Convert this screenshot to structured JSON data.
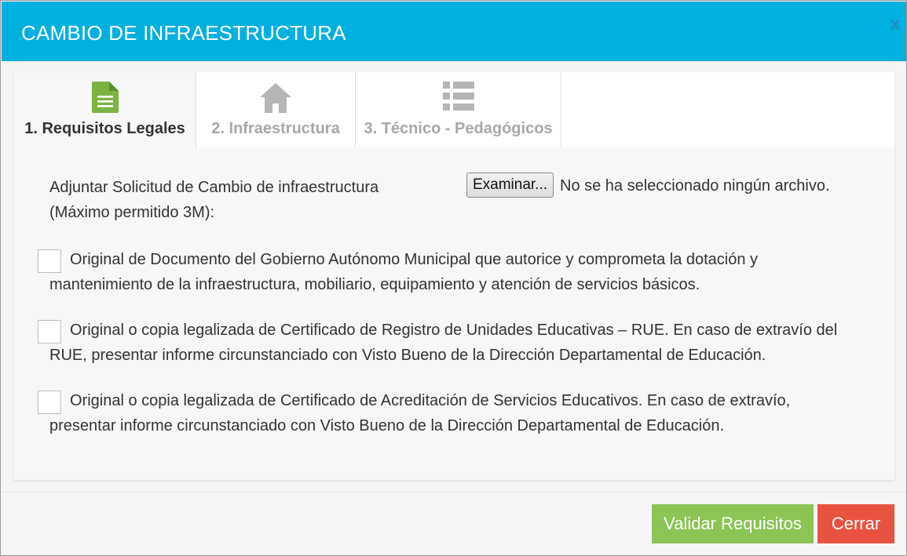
{
  "dialog": {
    "title": "CAMBIO DE INFRAESTRUCTURA",
    "close_label": "x"
  },
  "tabs": [
    {
      "label": "1. Requisitos Legales",
      "icon": "document-icon",
      "active": true,
      "icon_color": "#7cb342"
    },
    {
      "label": "2. Infraestructura",
      "icon": "home-icon",
      "active": false,
      "icon_color": "#b5b5b5"
    },
    {
      "label": "3. Técnico - Pedagógicos",
      "icon": "list-icon",
      "active": false,
      "icon_color": "#b5b5b5"
    }
  ],
  "attachment": {
    "label_line1": "Adjuntar Solicitud de Cambio de infraestructura",
    "label_line2": "(Máximo permitido 3M):",
    "browse_label": "Examinar...",
    "status": "No se ha seleccionado ningún archivo."
  },
  "requirements": [
    {
      "line1": "Original de Documento del Gobierno Autónomo Municipal que autorice y comprometa la dotación y",
      "line2": "mantenimiento de la infraestructura, mobiliario, equipamiento y atención de servicios básicos.",
      "checked": false
    },
    {
      "line1": "Original o copia legalizada de Certificado de Registro de Unidades Educativas – RUE. En caso de extravío del",
      "line2": "RUE, presentar informe circunstanciado con Visto Bueno de la Dirección Departamental de Educación.",
      "checked": false
    },
    {
      "line1": "Original o copia legalizada de Certificado de Acreditación de Servicios Educativos. En caso de extravío,",
      "line2": "presentar informe circunstanciado con Visto Bueno de la Dirección Departamental de Educación.",
      "checked": false
    }
  ],
  "footer": {
    "validate_label": "Validar Requisitos",
    "close_label": "Cerrar"
  },
  "colors": {
    "header": "#00b0e0",
    "validate": "#8cc455",
    "close": "#e8533f"
  }
}
